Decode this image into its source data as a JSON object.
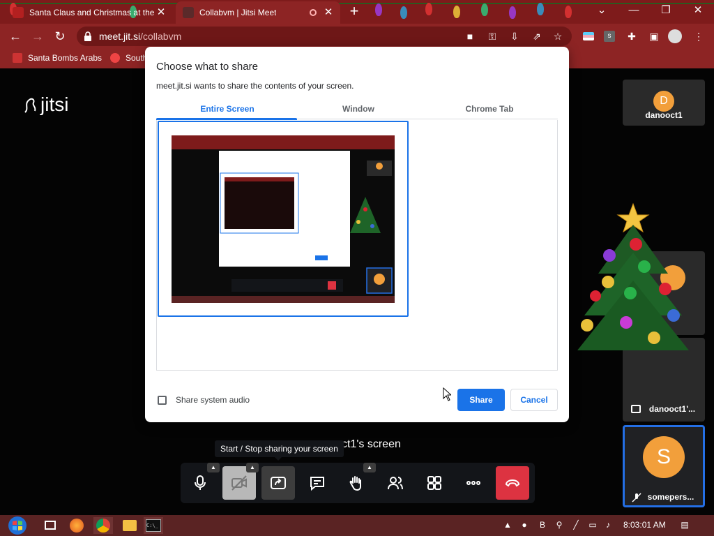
{
  "browser": {
    "tabs": [
      {
        "title": "Santa Claus and Christmas at the",
        "active": false
      },
      {
        "title": "Collabvm | Jitsi Meet",
        "active": true
      }
    ],
    "url_host": "meet.jit.si",
    "url_path": "/collabvm",
    "bookmarks": [
      "Santa Bombs Arabs",
      "South"
    ],
    "colors": {
      "frame": "#8d2424",
      "accent": "#1a73e8"
    }
  },
  "jitsi": {
    "logo": "jitsi",
    "participants": [
      {
        "initial": "D",
        "name": "danooct1"
      },
      {
        "name": "danooct1'..."
      },
      {
        "initial": "S",
        "name": "somepers..."
      }
    ],
    "screen_label": "ct1's screen",
    "tooltip": "Start / Stop sharing your screen",
    "toolbar_icons": [
      "microphone-icon",
      "camera-off-icon",
      "share-screen-icon",
      "chat-icon",
      "raise-hand-icon",
      "participants-icon",
      "tile-view-icon",
      "more-icon",
      "hangup-icon"
    ]
  },
  "dialog": {
    "title": "Choose what to share",
    "subtitle": "meet.jit.si wants to share the contents of your screen.",
    "tabs": [
      "Entire Screen",
      "Window",
      "Chrome Tab"
    ],
    "active_tab": "Entire Screen",
    "audio_label": "Share system audio",
    "share_label": "Share",
    "cancel_label": "Cancel"
  },
  "taskbar": {
    "time": "8:03:01 AM"
  }
}
